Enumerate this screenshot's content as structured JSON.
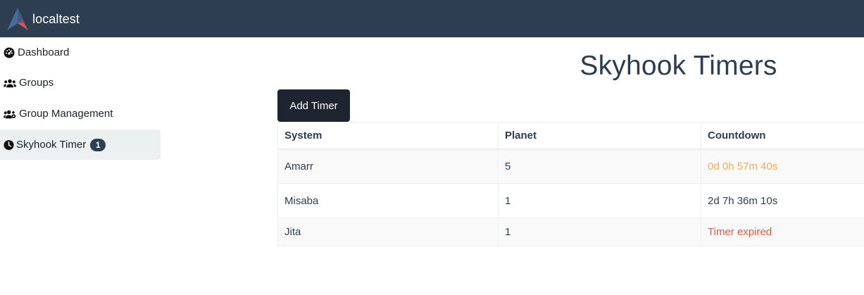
{
  "navbar": {
    "brand": "localtest"
  },
  "sidebar": {
    "items": [
      {
        "label": "Dashboard",
        "icon": "dashboard-icon"
      },
      {
        "label": "Groups",
        "icon": "users-icon"
      },
      {
        "label": "Group Management",
        "icon": "users-cog-icon"
      },
      {
        "label": "Skyhook Timer",
        "icon": "clock-icon",
        "badge": "1",
        "active": true
      }
    ]
  },
  "page": {
    "title": "Skyhook Timers"
  },
  "toolbar": {
    "add_label": "Add Timer"
  },
  "table": {
    "headers": [
      "System",
      "Planet",
      "Countdown"
    ],
    "rows": [
      {
        "system": "Amarr",
        "planet": "5",
        "countdown": "0d 0h 57m 40s",
        "status": "warning"
      },
      {
        "system": "Misaba",
        "planet": "1",
        "countdown": "2d 7h 36m 10s",
        "status": "normal"
      },
      {
        "system": "Jita",
        "planet": "1",
        "countdown": "Timer expired",
        "status": "expired"
      }
    ]
  },
  "colors": {
    "navbar": "#2c3e50",
    "button": "#1e2530",
    "warning": "#f0ad4e",
    "danger": "#dd5a43",
    "active_item": "#ecf0f1"
  }
}
